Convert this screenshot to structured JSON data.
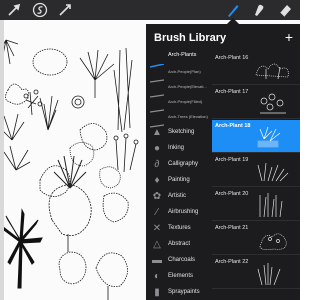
{
  "toolbar": {
    "tools": [
      {
        "name": "adjustments-icon"
      },
      {
        "name": "selection-icon"
      },
      {
        "name": "transform-icon"
      },
      {
        "name": "brush-icon",
        "active": true
      },
      {
        "name": "smudge-icon"
      },
      {
        "name": "eraser-icon"
      }
    ],
    "accent_color": "#1e8ef7"
  },
  "library": {
    "title": "Brush Library",
    "add_label": "+",
    "categories": [
      {
        "label": "Arch-Plants",
        "active": true
      },
      {
        "label": "Arch-People(Plan)"
      },
      {
        "label": "Arch-People(Elevati..."
      },
      {
        "label": "Arch-People(Filled)"
      },
      {
        "label": "Arch-Trees (Elevation)"
      },
      {
        "label": "Sketching",
        "icon": "pencil-icon"
      },
      {
        "label": "Inking",
        "icon": "ink-drop-icon"
      },
      {
        "label": "Calligraphy",
        "icon": "calligraphy-icon"
      },
      {
        "label": "Painting",
        "icon": "paint-drop-icon"
      },
      {
        "label": "Artistic",
        "icon": "palette-icon"
      },
      {
        "label": "Airbrushing",
        "icon": "airbrush-icon"
      },
      {
        "label": "Textures",
        "icon": "texture-icon"
      },
      {
        "label": "Abstract",
        "icon": "triangle-icon"
      },
      {
        "label": "Charcoals",
        "icon": "charcoal-icon"
      },
      {
        "label": "Elements",
        "icon": "yin-yang-icon"
      },
      {
        "label": "Spraypaints",
        "icon": "spray-can-icon"
      }
    ],
    "brushes": [
      {
        "name": "Arch-Plant 16"
      },
      {
        "name": "Arch-Plant 17"
      },
      {
        "name": "Arch-Plant 18",
        "selected": true
      },
      {
        "name": "Arch-Plant 19"
      },
      {
        "name": "Arch-Plant 20"
      },
      {
        "name": "Arch-Plant 21"
      },
      {
        "name": "Arch-Plant 22"
      }
    ]
  }
}
